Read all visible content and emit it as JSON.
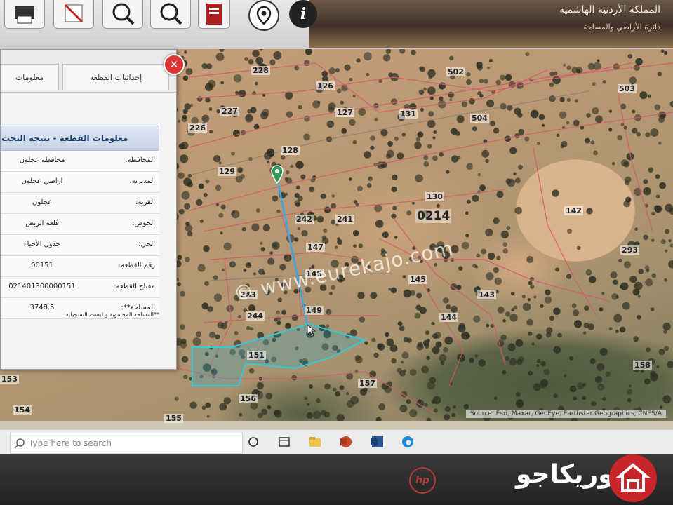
{
  "header": {
    "org_title": "المملكة الأردنية الهاشمية",
    "org_subtitle": "دائرة الأراضي والمساحة"
  },
  "toolbar": {
    "tools": [
      "print-icon",
      "erase-icon",
      "zoom-in-icon",
      "zoom-search-icon",
      "report-icon"
    ],
    "location_button": "location-pin-icon",
    "info_button": "i"
  },
  "panel": {
    "tabs": [
      "إحداثيات القطعة",
      "معلومات"
    ],
    "result_title": "معلومات القطعة - نتيجة البحث",
    "rows": [
      {
        "label": "المحافظة:",
        "value": "محافظة عجلون"
      },
      {
        "label": "المديرية:",
        "value": "اراضي عجلون"
      },
      {
        "label": "القرية:",
        "value": "عجلون"
      },
      {
        "label": "الحوض:",
        "value": "قلعة الربض"
      },
      {
        "label": "الحي:",
        "value": "جدول الأحياء"
      },
      {
        "label": "رقم القطعة:",
        "value": "00151"
      },
      {
        "label": "مفتاح القطعة:",
        "value": "021401300000151"
      },
      {
        "label": "المساحة**:",
        "value": "3748.5"
      }
    ],
    "note": "**المساحة المحسوبة و ليست التسجيلية"
  },
  "map": {
    "watermark": "© www.eurekajo.com",
    "basin_number": "0214",
    "attribution": "Source: Esri, Maxar, GeoEye, Earthstar Geographics, CNES/A",
    "parcel_labels": [
      "228",
      "126",
      "502",
      "503",
      "227",
      "127",
      "131",
      "504",
      "226",
      "128",
      "129",
      "130",
      "142",
      "242",
      "241",
      "147",
      "293",
      "148",
      "145",
      "143",
      "243",
      "149",
      "244",
      "144",
      "151",
      "158",
      "157",
      "156",
      "155",
      "154",
      "153"
    ]
  },
  "taskbar": {
    "search_placeholder": "Type here to search"
  },
  "device": {
    "brand": "hp"
  },
  "branding": {
    "text": "يوريكاجو"
  }
}
